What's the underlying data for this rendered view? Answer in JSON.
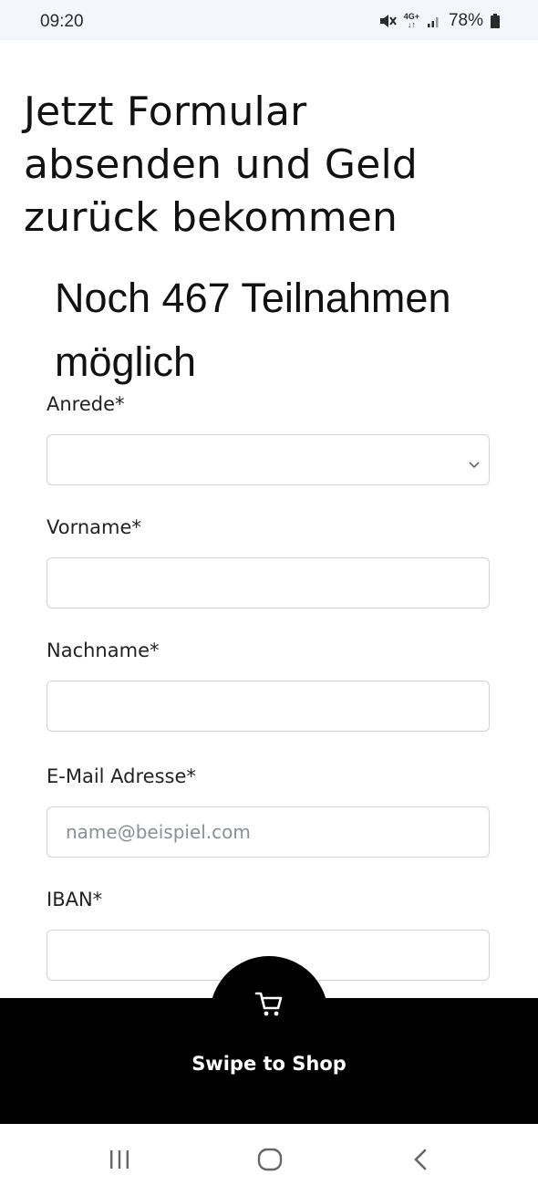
{
  "status_bar": {
    "time": "09:20",
    "network_top": "4G+",
    "network_bottom": "↓↑",
    "battery": "78%",
    "icons": [
      "mute-icon",
      "signal-icon",
      "battery-icon"
    ]
  },
  "page": {
    "title": "Jetzt Formular absenden und Geld zurück bekommen",
    "counter": "Noch 467 Teilnahmen möglich"
  },
  "form": {
    "salutation": {
      "label": "Anrede*",
      "value": ""
    },
    "first_name": {
      "label": "Vorname*",
      "value": ""
    },
    "last_name": {
      "label": "Nachname*",
      "value": ""
    },
    "email": {
      "label": "E-Mail Adresse*",
      "placeholder": "name@beispiel.com",
      "value": ""
    },
    "iban": {
      "label": "IBAN*",
      "value": ""
    }
  },
  "shop_bar": {
    "label": "Swipe to Shop",
    "icon": "cart-icon",
    "background": "#000000",
    "text_color": "#ffffff"
  },
  "nav_bar": {
    "buttons": [
      "recent-apps-icon",
      "home-icon",
      "back-icon"
    ]
  }
}
